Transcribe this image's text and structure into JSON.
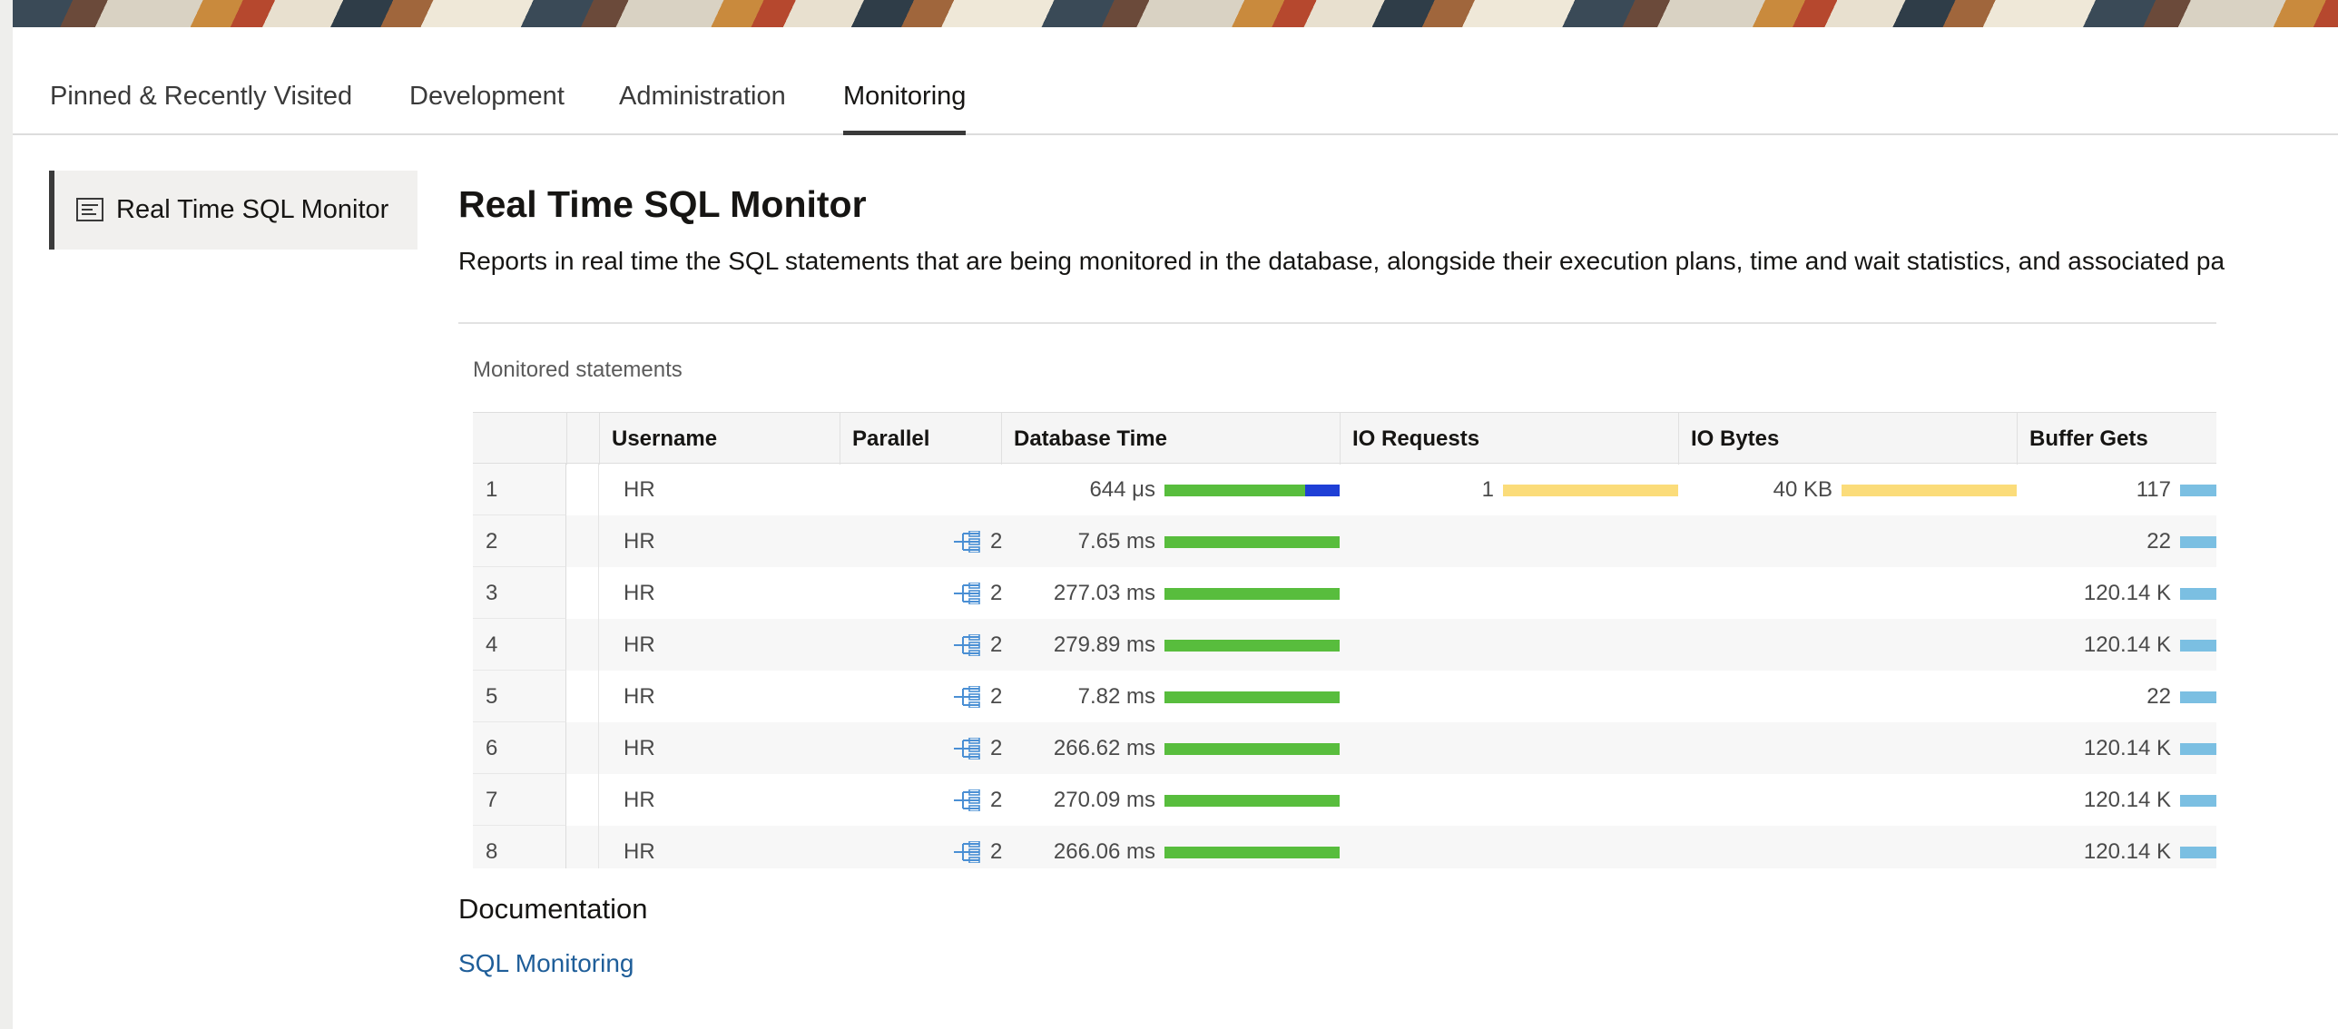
{
  "tabs": [
    {
      "label": "Pinned & Recently Visited",
      "active": false
    },
    {
      "label": "Development",
      "active": false
    },
    {
      "label": "Administration",
      "active": false
    },
    {
      "label": "Monitoring",
      "active": true
    }
  ],
  "sidebar": {
    "items": [
      {
        "label": "Real Time SQL Monitor",
        "icon": "report-icon",
        "selected": true
      }
    ]
  },
  "main": {
    "title": "Real Time SQL Monitor",
    "description": "Reports in real time the SQL statements that are being monitored in the database, alongside their execution plans, time and wait statistics, and associated pa",
    "card_title": "Monitored statements",
    "columns": [
      "Username",
      "Parallel",
      "Database Time",
      "IO Requests",
      "IO Bytes",
      "Buffer Gets"
    ],
    "rows": [
      {
        "num": "1",
        "user": "HR",
        "parallel": "",
        "db_time": "644 μs",
        "io_requests": "1",
        "io_bytes": "40 KB",
        "buffer_gets": "117"
      },
      {
        "num": "2",
        "user": "HR",
        "parallel": "2",
        "db_time": "7.65 ms",
        "io_requests": "",
        "io_bytes": "",
        "buffer_gets": "22"
      },
      {
        "num": "3",
        "user": "HR",
        "parallel": "2",
        "db_time": "277.03 ms",
        "io_requests": "",
        "io_bytes": "",
        "buffer_gets": "120.14 K"
      },
      {
        "num": "4",
        "user": "HR",
        "parallel": "2",
        "db_time": "279.89 ms",
        "io_requests": "",
        "io_bytes": "",
        "buffer_gets": "120.14 K"
      },
      {
        "num": "5",
        "user": "HR",
        "parallel": "2",
        "db_time": "7.82 ms",
        "io_requests": "",
        "io_bytes": "",
        "buffer_gets": "22"
      },
      {
        "num": "6",
        "user": "HR",
        "parallel": "2",
        "db_time": "266.62 ms",
        "io_requests": "",
        "io_bytes": "",
        "buffer_gets": "120.14 K"
      },
      {
        "num": "7",
        "user": "HR",
        "parallel": "2",
        "db_time": "270.09 ms",
        "io_requests": "",
        "io_bytes": "",
        "buffer_gets": "120.14 K"
      },
      {
        "num": "8",
        "user": "HR",
        "parallel": "2",
        "db_time": "266.06 ms",
        "io_requests": "",
        "io_bytes": "",
        "buffer_gets": "120.14 K"
      }
    ]
  },
  "documentation": {
    "heading": "Documentation",
    "link": "SQL Monitoring"
  },
  "colors": {
    "green": "#58bd3d",
    "blue": "#1f3fd6",
    "yellow": "#fbdc7a",
    "lightblue": "#7bbfe2",
    "link": "#1f5e99"
  }
}
